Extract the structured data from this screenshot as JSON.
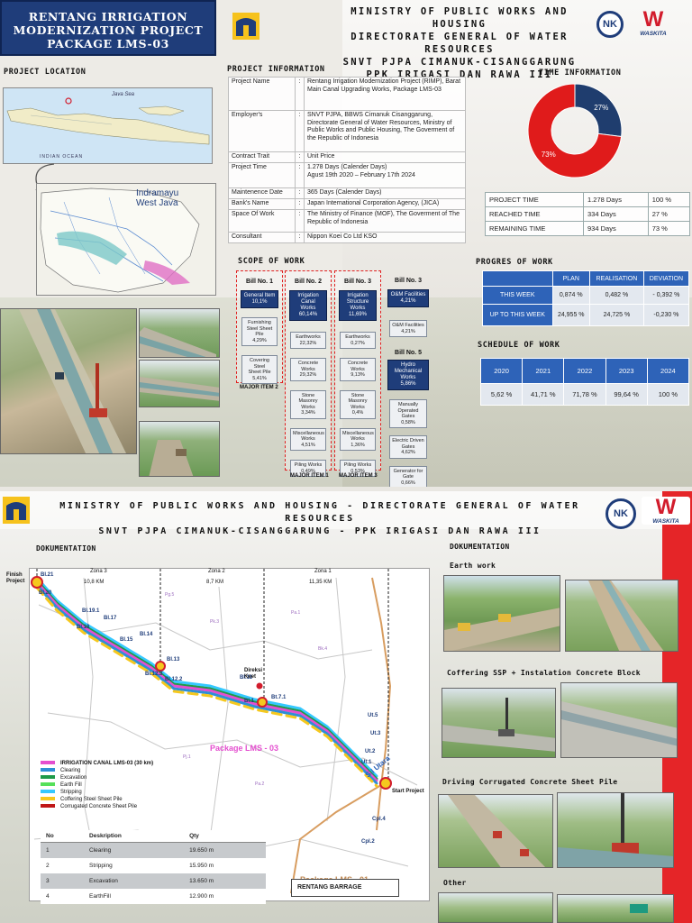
{
  "page1": {
    "title_lines": [
      "RENTANG IRRIGATION",
      "MODERNIZATION PROJECT",
      "PACKAGE LMS-03"
    ],
    "ministry_lines": [
      "MINISTRY OF PUBLIC WORKS AND HOUSING",
      "DIRECTORATE GENERAL OF WATER RESOURCES",
      "SNVT PJPA CIMANUK-CISANGGARUNG",
      "PPK IRIGASI DAN RAWA III"
    ],
    "logos": {
      "nk": "NK",
      "waskita": "WASKITA"
    },
    "project_location": {
      "title": "PROJECT LOCATION",
      "sea_label": "Java Sea",
      "ocean_label": "INDIAN   OCEAN",
      "inset_label_lines": [
        "Indramayu",
        "West Java"
      ]
    },
    "project_information": {
      "title": "PROJECT INFORMATION",
      "rows": [
        {
          "key": "Project Name",
          "value": "Rentang Irrigation Modernization Project (RIMP), Barat Main Canal Upgrading Works, Package LMS-03"
        },
        {
          "key": "Employer's",
          "value": "SNVT PJPA, BBWS Cimanuk Cisanggarung, Directorate General of Water Resources, Ministry of Public Works and Public Housing, The Goverment of the Republic of Indonesia"
        },
        {
          "key": "Contract Trait",
          "value": "Unit Price"
        },
        {
          "key": "Project Time",
          "value": "1.278 Days (Calender Days)\nAgust 19th 2020 – February 17th 2024"
        },
        {
          "key": "Maintenence Date",
          "value": "365 Days (Calender Days)"
        },
        {
          "key": "Bank's Name",
          "value": "Japan International Corporation Agency, (JICA)"
        },
        {
          "key": "Space Of Work",
          "value": "The Ministry of Finance (MOF), The Goverment of The Republic of Indonesia"
        },
        {
          "key": "Consultant",
          "value": "Nippon Koei Co Ltd KSO"
        }
      ]
    },
    "time_information": {
      "title": "TIME INFORMATION",
      "chart_data": {
        "type": "pie",
        "title": "",
        "slices": [
          {
            "label": "27%",
            "value": 27,
            "color": "#1f3d6e"
          },
          {
            "label": "73%",
            "value": 73,
            "color": "#e01b1b"
          }
        ]
      },
      "rows": [
        {
          "label": "PROJECT TIME",
          "days": "1.278 Days",
          "pct": "100 %"
        },
        {
          "label": "REACHED TIME",
          "days": "334  Days",
          "pct": "27 %"
        },
        {
          "label": "REMAINING TIME",
          "days": "934  Days",
          "pct": "73 %"
        }
      ]
    },
    "scope": {
      "title": "SCOPE OF WORK",
      "bill1": {
        "title": "Bill No. 1",
        "head": "General Item\n10,1%",
        "items": [
          "Furnishing\nSteel Sheet Pile\n4,29%",
          "Covering Steel\nSheet Pile\n5,41%"
        ]
      },
      "bill2": {
        "title": "Bill No. 2",
        "head": "Irrigation Canal\nWorks\n60,14%",
        "items": [
          "Earthworks\n22,32%",
          "Concrete\nWorks\n29,32%",
          "Stone Masonry\nWorks\n3,34%",
          "Miscellaneous\nWorks\n4,51%",
          "Piling Works\n0,49%"
        ]
      },
      "bill3": {
        "title": "Bill No. 3",
        "head": "Irrigation\nStructure Works\n11,69%",
        "items": [
          "Earthworks\n0,27%",
          "Concrete\nWorks\n9,13%",
          "Stone Masonry\nWorks\n0,4%",
          "Miscellaneous\nWorks\n1,36%",
          "Piling Works\n0,53%"
        ]
      },
      "bill3b": {
        "title": "Bill No. 3",
        "head": "O&M Facilities\n4,21%",
        "items": [
          "O&M Facilities\n4,21%"
        ]
      },
      "bill5": {
        "title": "Bill No. 5",
        "head": "Hydro Mechanical\nWorks\n5,86%",
        "items": [
          "Manually\nOperated Gates\n0,58%",
          "Electric Driven\nGates\n4,62%",
          "Generator for\nGate\n0,66%"
        ]
      },
      "major_items": [
        "MAJOR ITEM 2",
        "MAJOR ITEM 1",
        "MAJOR ITEM 3"
      ]
    },
    "progress": {
      "title": "PROGRES OF WORK",
      "headers": [
        "",
        "PLAN",
        "REALISATION",
        "DEVIATION"
      ],
      "rows": [
        [
          "THIS WEEK",
          "0,874 %",
          "0,482 %",
          "- 0,392 %"
        ],
        [
          "UP TO THIS WEEK",
          "24,955 %",
          "24,725 %",
          "-0,230 %"
        ]
      ]
    },
    "schedule": {
      "title": "SCHEDULE OF WORK",
      "chart_data": {
        "type": "table",
        "categories": [
          "2020",
          "2021",
          "2022",
          "2023",
          "2024"
        ],
        "values": [
          "5,62 %",
          "41,71 %",
          "71,78 %",
          "99,64 %",
          "100 %"
        ]
      }
    }
  },
  "page2": {
    "ministry_lines": [
      "MINISTRY OF PUBLIC WORKS AND HOUSING - DIRECTORATE GENERAL OF WATER RESOURCES",
      "SNVT PJPA CIMANUK-CISANGGARUNG - PPK IRIGASI DAN RAWA III"
    ],
    "logos": {
      "nk": "NK",
      "waskita": "WASKITA"
    },
    "doc_title_left": "DOKUMENTATION",
    "doc_title_right": "DOKUMENTATION",
    "map": {
      "zones": [
        {
          "name": "Zona 3",
          "km": "10,8 KM"
        },
        {
          "name": "Zona 2",
          "km": "8,7 KM"
        },
        {
          "name": "Zona 1",
          "km": "11,35 KM"
        }
      ],
      "finish_label": "Finish\nProject",
      "start_label": "Start Project",
      "direksi_label": "Direksi\nKeet",
      "package_lms03": "Package LMS - 03",
      "package_lms01": "Package LMS - 01",
      "river_label": "S.I Utara",
      "barrage": "RENTANG BARRAGE",
      "station_labels": [
        "Bl.21",
        "Bl.20",
        "Bl.19.1",
        "Bl.18",
        "Bl.17",
        "Bl.15",
        "Bl.14",
        "Bl.13",
        "Bl.12.3",
        "Bl.12.2",
        "Bl.1",
        "Bl.11",
        "Bt.7.1",
        "Ut.5",
        "Ut.3",
        "Ut.2",
        "Ut.1",
        "Cpl.4",
        "Cpl.2"
      ],
      "legend": [
        {
          "label": "IRRIGATION CANAL LMS-03 (30 km)",
          "color": "#e44fcf"
        },
        {
          "label": "Clearing",
          "color": "#2e8fd6"
        },
        {
          "label": "Excavation",
          "color": "#1e9a4a"
        },
        {
          "label": "Earth Fill",
          "color": "#55e05a"
        },
        {
          "label": "Stripping",
          "color": "#35c8ff"
        },
        {
          "label": "Coffering Steel Sheet Pile",
          "color": "#f5c81e"
        },
        {
          "label": "Corrugated Concrete Sheet Pile",
          "color": "#c01818"
        }
      ],
      "table": {
        "headers": [
          "No",
          "Deskription",
          "Qty"
        ],
        "rows": [
          [
            "1",
            "Clearing",
            "19.650 m"
          ],
          [
            "2",
            "Stripping",
            "15.950 m"
          ],
          [
            "3",
            "Excavation",
            "13.650 m"
          ],
          [
            "4",
            "EarthFill",
            "12.900 m"
          ]
        ]
      }
    },
    "photo_sections": [
      "Earth work",
      "Coffering SSP + Instalation Concrete Block",
      "Driving Corrugated Concrete Sheet Pile",
      "Other"
    ]
  }
}
